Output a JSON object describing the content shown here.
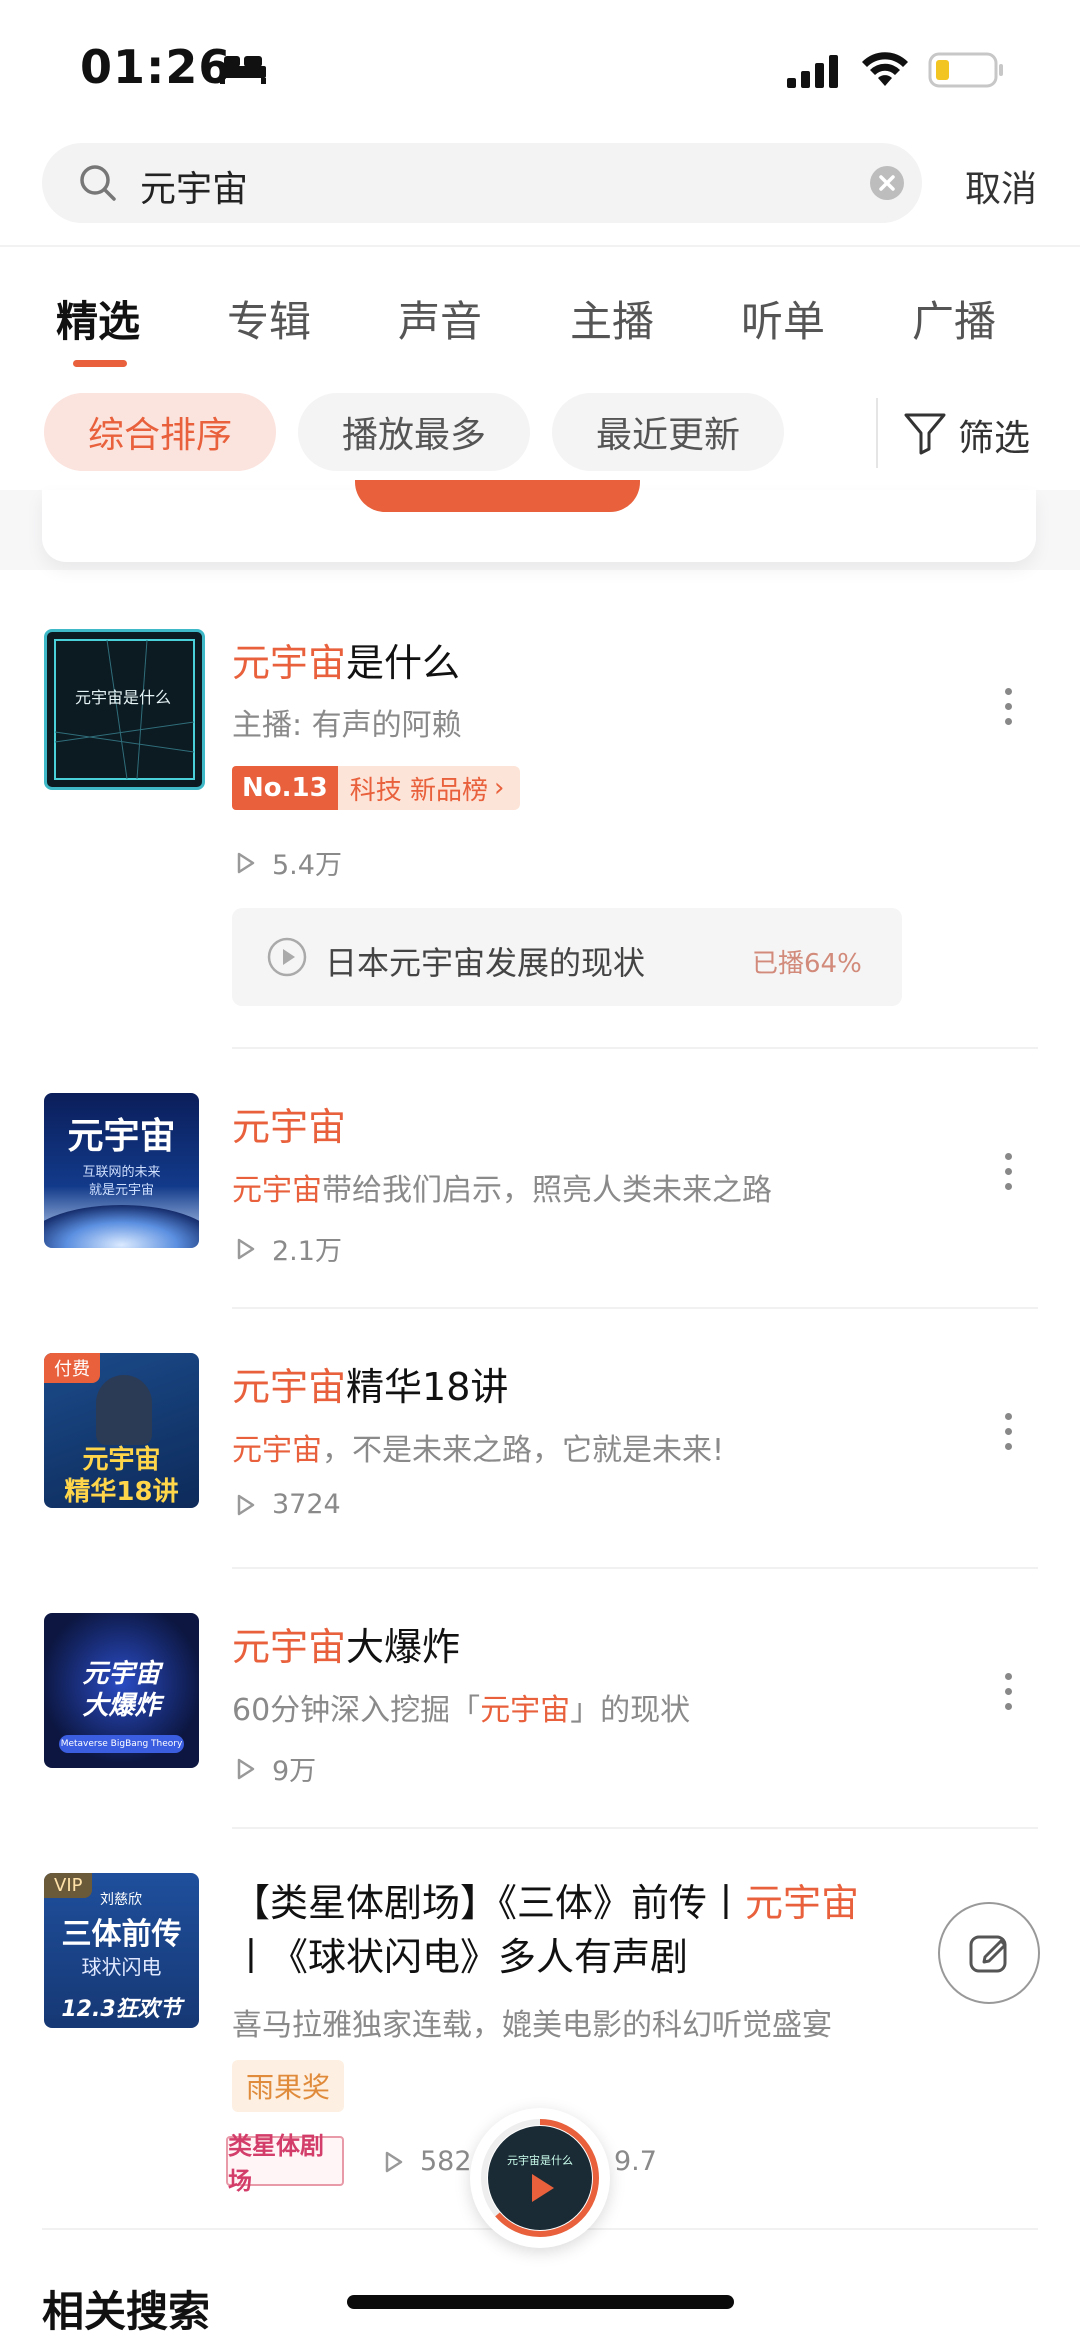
{
  "status_bar": {
    "time": "01:26"
  },
  "search": {
    "query": "元宇宙",
    "cancel_label": "取消"
  },
  "tabs": [
    {
      "label": "精选",
      "active": true
    },
    {
      "label": "专辑"
    },
    {
      "label": "声音"
    },
    {
      "label": "主播"
    },
    {
      "label": "听单"
    },
    {
      "label": "广播"
    }
  ],
  "filters": {
    "chips": [
      {
        "label": "综合排序",
        "active": true
      },
      {
        "label": "播放最多"
      },
      {
        "label": "最近更新"
      }
    ],
    "filter_label": "筛选"
  },
  "results": [
    {
      "cover_text": "元宇宙是什么",
      "title_hl": "元宇宙",
      "title_rest": "是什么",
      "anchor": "主播: 有声的阿赖",
      "rank_no": "No.13",
      "rank_text": "科技 新品榜",
      "plays": "5.4万",
      "recent_track": "日本元宇宙发展的现状",
      "recent_progress": "已播64%"
    },
    {
      "cover_text": "元宇宙",
      "cover_sub1": "互联网的未来",
      "cover_sub2": "就是元宇宙",
      "title_hl": "元宇宙",
      "title_rest": "",
      "desc_hl": "元宇宙",
      "desc_rest": "带给我们启示，照亮人类未来之路",
      "plays": "2.1万"
    },
    {
      "cover_badge": "付费",
      "cover_line1": "元宇宙",
      "cover_line2": "精华18讲",
      "title_hl": "元宇宙",
      "title_rest": "精华18讲",
      "desc_hl": "元宇宙",
      "desc_rest": "，不是未来之路，它就是未来!",
      "plays": "3724"
    },
    {
      "cover_line1": "元宇宙",
      "cover_line2": "大爆炸",
      "cover_caption": "Metaverse BigBang Theory",
      "title_hl": "元宇宙",
      "title_rest": "大爆炸",
      "desc_pre": "60分钟深入挖掘「",
      "desc_hl": "元宇宙",
      "desc_post": "」的现状",
      "plays": "9万"
    },
    {
      "cover_badge": "VIP",
      "cover_author": "刘慈欣",
      "cover_line1": "三体前传",
      "cover_line2": "球状闪电",
      "cover_line3": "12.3狂欢节",
      "title_pre": "【类星体剧场】《三体》前传丨",
      "title_hl": "元宇宙",
      "title_line2": "丨《球状闪电》多人有声剧",
      "desc": "喜马拉雅独家连载，媲美电影的科幻听觉盛宴",
      "award": "雨果奖",
      "label_logo": "类星体剧场",
      "plays_partial": "582",
      "score_partial": "9.7"
    }
  ],
  "mini_player": {
    "cover_text": "元宇宙是什么"
  },
  "related_title": "相关搜索",
  "colors": {
    "accent": "#e8613c"
  }
}
